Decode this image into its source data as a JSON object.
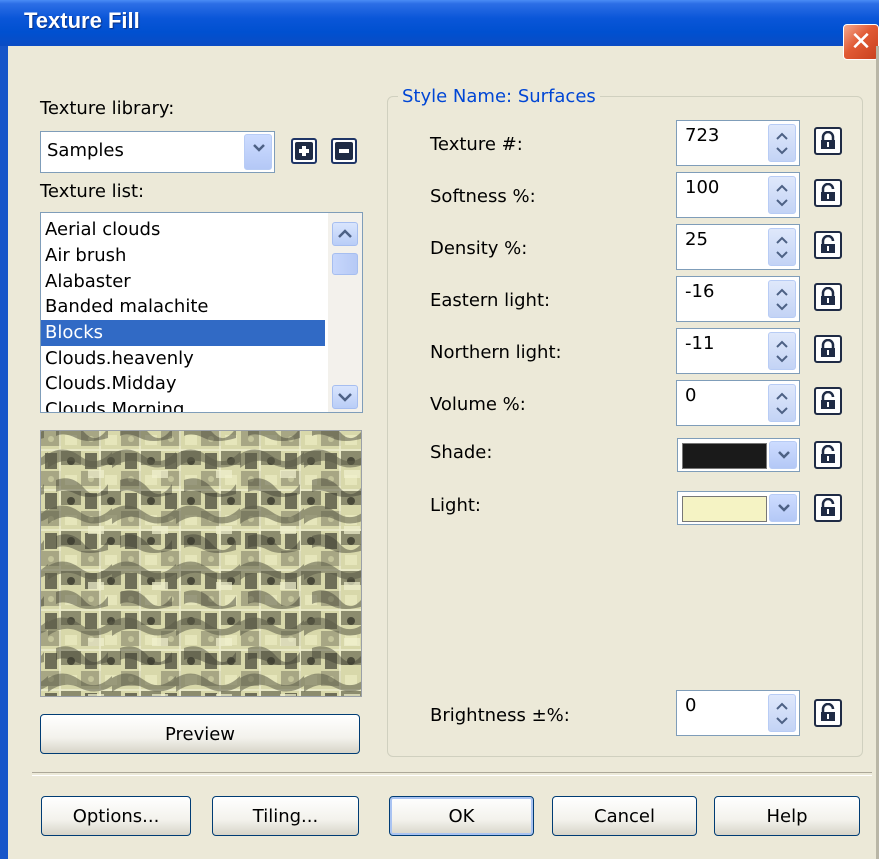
{
  "window": {
    "title": "Texture Fill",
    "close_glyph": "✕"
  },
  "library": {
    "label": "Texture library:",
    "selected": "Samples",
    "add_icon": "plus-icon",
    "remove_icon": "minus-icon"
  },
  "list": {
    "label": "Texture list:",
    "items": [
      "Aerial clouds",
      "Air brush",
      "Alabaster",
      "Banded malachite",
      "Blocks",
      "Clouds.heavenly",
      "Clouds.Midday",
      "Clouds.Morning"
    ],
    "selected_index": 4
  },
  "preview_button": "Preview",
  "style": {
    "group_title": "Style Name: Surfaces",
    "fields": [
      {
        "label": "Texture #:",
        "value": "723",
        "locked": true
      },
      {
        "label": "Softness %:",
        "value": "100",
        "locked": false
      },
      {
        "label": "Density %:",
        "value": "25",
        "locked": false
      },
      {
        "label": "Eastern light:",
        "value": "-16",
        "locked": true
      },
      {
        "label": "Northern light:",
        "value": "-11",
        "locked": true
      },
      {
        "label": "Volume %:",
        "value": "0",
        "locked": false
      }
    ],
    "shade": {
      "label": "Shade:",
      "color": "#1a1a1a",
      "locked": false
    },
    "light": {
      "label": "Light:",
      "color": "#f5f3c4",
      "locked": false
    },
    "brightness": {
      "label": "Brightness ±%:",
      "value": "0",
      "locked": false
    }
  },
  "buttons": {
    "options": "Options...",
    "tiling": "Tiling...",
    "ok": "OK",
    "cancel": "Cancel",
    "help": "Help"
  }
}
